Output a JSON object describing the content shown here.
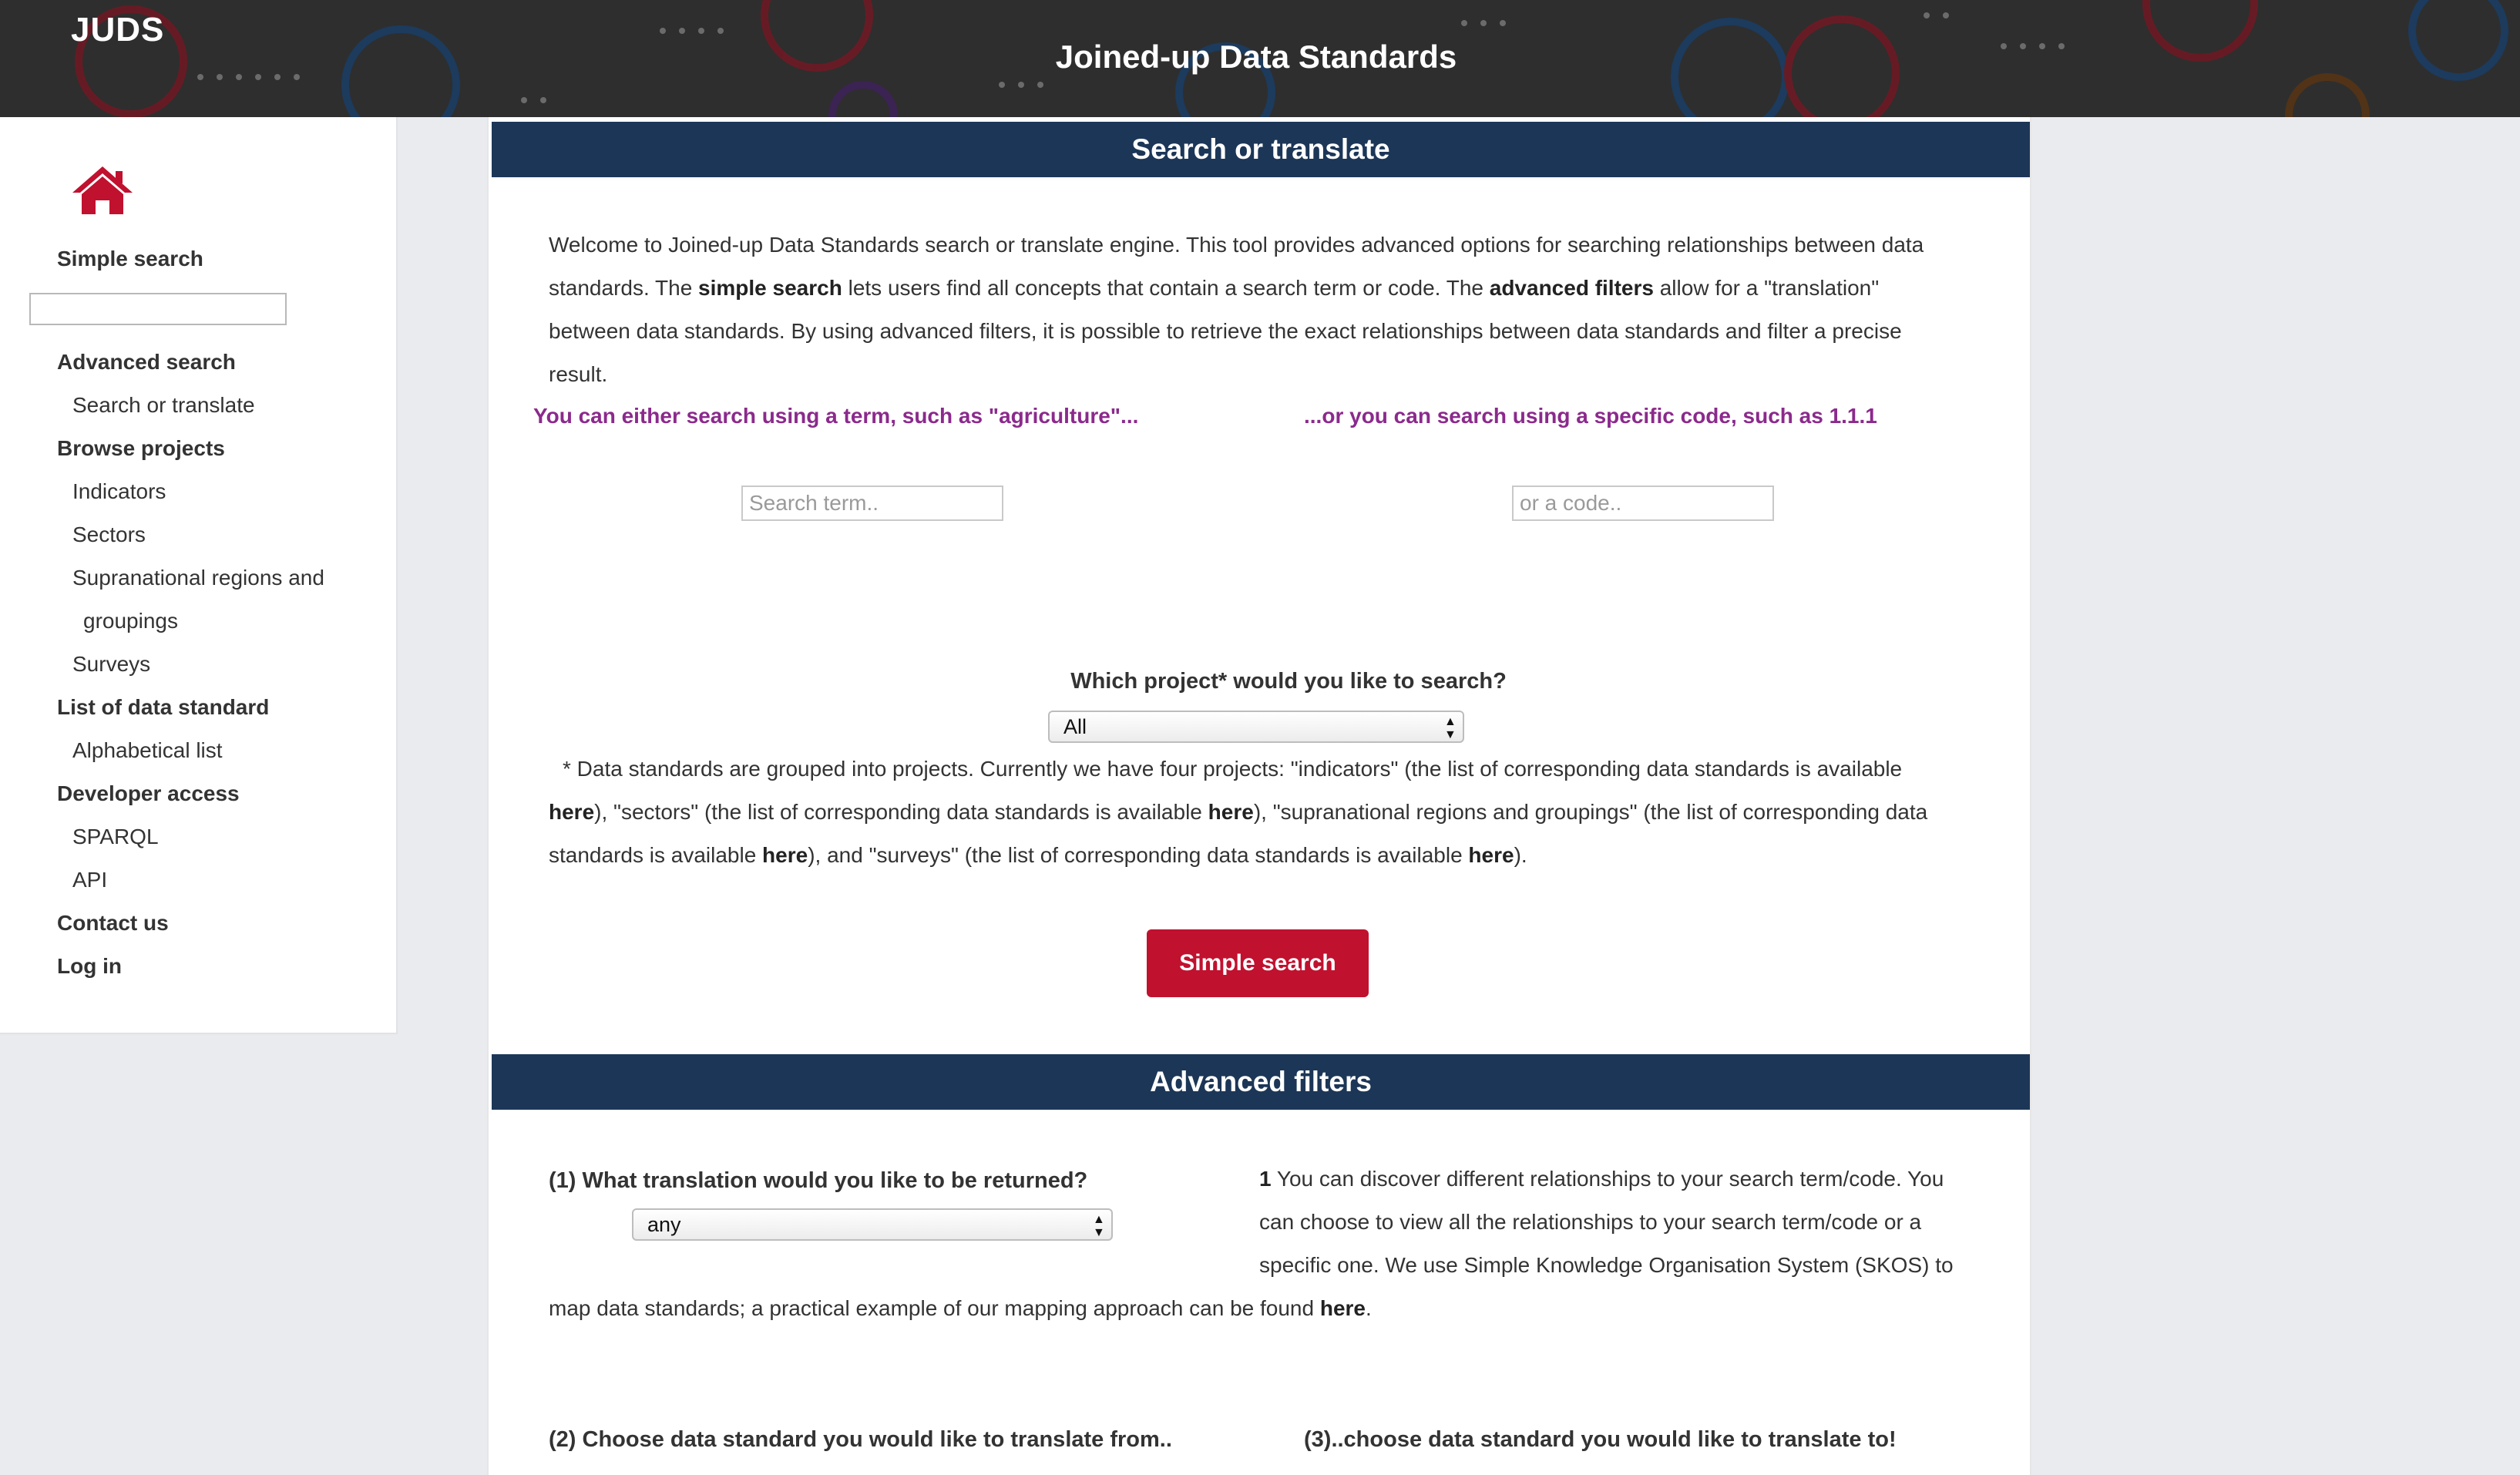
{
  "header": {
    "brand": "JUDS",
    "title": "Joined-up Data Standards"
  },
  "sidebar": {
    "simple_search_label": "Simple search",
    "advanced_search_label": "Advanced search",
    "search_or_translate": "Search or translate",
    "browse_projects_label": "Browse projects",
    "browse_items": [
      "Indicators",
      "Sectors",
      "Supranational regions and",
      "groupings",
      "Surveys"
    ],
    "list_of_data_standard_label": "List of data standard",
    "alphabetical_list": "Alphabetical list",
    "developer_access_label": "Developer access",
    "sparql": "SPARQL",
    "api": "API",
    "contact_us": "Contact us",
    "log_in": "Log in"
  },
  "search": {
    "heading": "Search or translate",
    "intro": {
      "l1": "Welcome to Joined-up Data Standards search or translate engine. This tool provides advanced options for searching relationships between data",
      "l2a": "standards. The ",
      "l2b": "simple search",
      "l2c": " lets users find all concepts that contain a search term or code. The ",
      "l2d": "advanced filters",
      "l2e": " allow for a \"translation\"",
      "l3": "between data standards. By using advanced filters, it is possible to retrieve the exact relationships between data standards and filter a precise result."
    },
    "term_hint": "You can either search using a term, such as \"agriculture\"...",
    "code_hint": "...or you can search using a specific code, such as 1.1.1",
    "term_placeholder": "Search term..",
    "code_placeholder": "or a code..",
    "project_question": "Which project* would you like to search?",
    "project_selected": "All",
    "note": {
      "l1": "* Data standards are grouped into projects. Currently we have four projects: \"indicators\" (the list of corresponding data standards is available",
      "here": "here",
      "l2a": "), \"sectors\" (the list of corresponding data standards is available ",
      "l2b": "), \"supranational regions and groupings\" (the list of corresponding data",
      "l3a": "standards is available ",
      "l3b": "), and \"surveys\" (the list of corresponding data standards is available ",
      "l3c": ")."
    },
    "button_label": "Simple search"
  },
  "advanced": {
    "heading": "Advanced filters",
    "q1": "(1) What translation would you like to be returned?",
    "q1_selected": "any",
    "info": {
      "num": "1",
      "l1": " You can discover different relationships to your search term/code. You",
      "l2": "can choose to view all the relationships to your search term/code or a",
      "l3": "specific one. We use Simple Knowledge Organisation System (SKOS) to",
      "l4a": "map data standards; a practical example of our mapping approach can be found ",
      "here": "here",
      "l4b": "."
    },
    "q2": "(2) Choose data standard you would like to translate from..",
    "q3": "(3)..choose data standard you would like to translate to!"
  },
  "colors": {
    "header_bg": "#2e2e2e",
    "section_bar": "#1c3657",
    "accent_red": "#c0112f",
    "hint_purple": "#8b2a8c"
  }
}
